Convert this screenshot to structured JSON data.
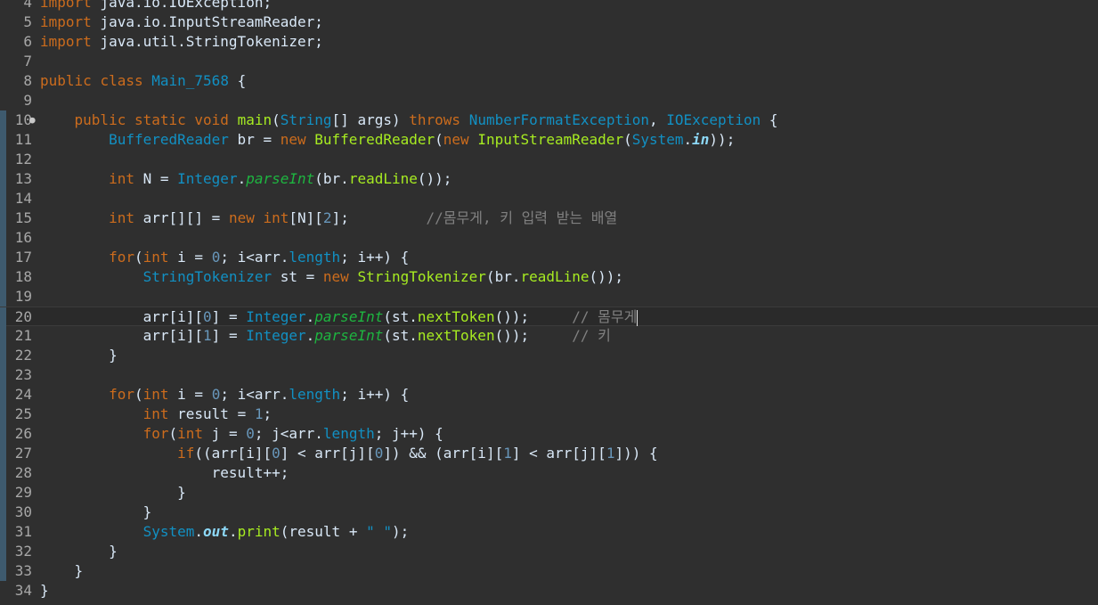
{
  "editor": {
    "fold_marker": "●",
    "lines": [
      {
        "n": "4",
        "tokens": [
          {
            "t": "import",
            "c": "kw"
          },
          {
            "t": " java.io.IOException;"
          }
        ]
      },
      {
        "n": "5",
        "tokens": [
          {
            "t": "import",
            "c": "kw"
          },
          {
            "t": " java.io.InputStreamReader;"
          }
        ]
      },
      {
        "n": "6",
        "tokens": [
          {
            "t": "import",
            "c": "kw"
          },
          {
            "t": " java.util.StringTokenizer;"
          }
        ]
      },
      {
        "n": "7",
        "tokens": []
      },
      {
        "n": "8",
        "tokens": [
          {
            "t": "public",
            "c": "kw"
          },
          {
            "t": " "
          },
          {
            "t": "class",
            "c": "kw"
          },
          {
            "t": " "
          },
          {
            "t": "Main_7568",
            "c": "ty"
          },
          {
            "t": " {"
          }
        ]
      },
      {
        "n": "9",
        "tokens": []
      },
      {
        "n": "10",
        "bar": true,
        "fold": true,
        "tokens": [
          {
            "t": "    "
          },
          {
            "t": "public",
            "c": "kw"
          },
          {
            "t": " "
          },
          {
            "t": "static",
            "c": "kw"
          },
          {
            "t": " "
          },
          {
            "t": "void",
            "c": "kw"
          },
          {
            "t": " "
          },
          {
            "t": "main",
            "c": "fn"
          },
          {
            "t": "("
          },
          {
            "t": "String",
            "c": "ty"
          },
          {
            "t": "[] args) "
          },
          {
            "t": "throws",
            "c": "kw"
          },
          {
            "t": " "
          },
          {
            "t": "NumberFormatException",
            "c": "ty"
          },
          {
            "t": ", "
          },
          {
            "t": "IOException",
            "c": "ty"
          },
          {
            "t": " {"
          }
        ]
      },
      {
        "n": "11",
        "bar": true,
        "tokens": [
          {
            "t": "        "
          },
          {
            "t": "BufferedReader",
            "c": "ty"
          },
          {
            "t": " br = "
          },
          {
            "t": "new",
            "c": "kw"
          },
          {
            "t": " "
          },
          {
            "t": "BufferedReader",
            "c": "fn"
          },
          {
            "t": "("
          },
          {
            "t": "new",
            "c": "kw"
          },
          {
            "t": " "
          },
          {
            "t": "InputStreamReader",
            "c": "fn"
          },
          {
            "t": "("
          },
          {
            "t": "System",
            "c": "ty"
          },
          {
            "t": "."
          },
          {
            "t": "in",
            "c": "sfld"
          },
          {
            "t": "));"
          }
        ]
      },
      {
        "n": "12",
        "bar": true,
        "tokens": []
      },
      {
        "n": "13",
        "bar": true,
        "tokens": [
          {
            "t": "        "
          },
          {
            "t": "int",
            "c": "kw"
          },
          {
            "t": " N = "
          },
          {
            "t": "Integer",
            "c": "ty"
          },
          {
            "t": "."
          },
          {
            "t": "parseInt",
            "c": "st"
          },
          {
            "t": "(br."
          },
          {
            "t": "readLine",
            "c": "fn"
          },
          {
            "t": "());"
          }
        ]
      },
      {
        "n": "14",
        "bar": true,
        "tokens": []
      },
      {
        "n": "15",
        "bar": true,
        "tokens": [
          {
            "t": "        "
          },
          {
            "t": "int",
            "c": "kw"
          },
          {
            "t": " arr[][] = "
          },
          {
            "t": "new",
            "c": "kw"
          },
          {
            "t": " "
          },
          {
            "t": "int",
            "c": "kw"
          },
          {
            "t": "[N]["
          },
          {
            "t": "2",
            "c": "num"
          },
          {
            "t": "];         "
          },
          {
            "t": "//몸무게, 키 입력 받는 배열",
            "c": "cm"
          }
        ]
      },
      {
        "n": "16",
        "bar": true,
        "tokens": []
      },
      {
        "n": "17",
        "bar": true,
        "tokens": [
          {
            "t": "        "
          },
          {
            "t": "for",
            "c": "kw"
          },
          {
            "t": "("
          },
          {
            "t": "int",
            "c": "kw"
          },
          {
            "t": " i = "
          },
          {
            "t": "0",
            "c": "num"
          },
          {
            "t": "; i<arr."
          },
          {
            "t": "length",
            "c": "ty"
          },
          {
            "t": "; i++) {"
          }
        ]
      },
      {
        "n": "18",
        "bar": true,
        "tokens": [
          {
            "t": "            "
          },
          {
            "t": "StringTokenizer",
            "c": "ty"
          },
          {
            "t": " st = "
          },
          {
            "t": "new",
            "c": "kw"
          },
          {
            "t": " "
          },
          {
            "t": "StringTokenizer",
            "c": "fn"
          },
          {
            "t": "(br."
          },
          {
            "t": "readLine",
            "c": "fn"
          },
          {
            "t": "());"
          }
        ]
      },
      {
        "n": "19",
        "bar": true,
        "tokens": []
      },
      {
        "n": "20",
        "bar": true,
        "current": true,
        "cursor": true,
        "tokens": [
          {
            "t": "            arr[i]["
          },
          {
            "t": "0",
            "c": "num"
          },
          {
            "t": "] = "
          },
          {
            "t": "Integer",
            "c": "ty"
          },
          {
            "t": "."
          },
          {
            "t": "parseInt",
            "c": "st"
          },
          {
            "t": "(st."
          },
          {
            "t": "nextToken",
            "c": "fn"
          },
          {
            "t": "());     "
          },
          {
            "t": "// 몸무게",
            "c": "cm"
          }
        ]
      },
      {
        "n": "21",
        "bar": true,
        "tokens": [
          {
            "t": "            arr[i]["
          },
          {
            "t": "1",
            "c": "num"
          },
          {
            "t": "] = "
          },
          {
            "t": "Integer",
            "c": "ty"
          },
          {
            "t": "."
          },
          {
            "t": "parseInt",
            "c": "st"
          },
          {
            "t": "(st."
          },
          {
            "t": "nextToken",
            "c": "fn"
          },
          {
            "t": "());     "
          },
          {
            "t": "// 키",
            "c": "cm"
          }
        ]
      },
      {
        "n": "22",
        "bar": true,
        "tokens": [
          {
            "t": "        }"
          }
        ]
      },
      {
        "n": "23",
        "bar": true,
        "tokens": []
      },
      {
        "n": "24",
        "bar": true,
        "tokens": [
          {
            "t": "        "
          },
          {
            "t": "for",
            "c": "kw"
          },
          {
            "t": "("
          },
          {
            "t": "int",
            "c": "kw"
          },
          {
            "t": " i = "
          },
          {
            "t": "0",
            "c": "num"
          },
          {
            "t": "; i<arr."
          },
          {
            "t": "length",
            "c": "ty"
          },
          {
            "t": "; i++) {"
          }
        ]
      },
      {
        "n": "25",
        "bar": true,
        "tokens": [
          {
            "t": "            "
          },
          {
            "t": "int",
            "c": "kw"
          },
          {
            "t": " result = "
          },
          {
            "t": "1",
            "c": "num"
          },
          {
            "t": ";"
          }
        ]
      },
      {
        "n": "26",
        "bar": true,
        "tokens": [
          {
            "t": "            "
          },
          {
            "t": "for",
            "c": "kw"
          },
          {
            "t": "("
          },
          {
            "t": "int",
            "c": "kw"
          },
          {
            "t": " j = "
          },
          {
            "t": "0",
            "c": "num"
          },
          {
            "t": "; j<arr."
          },
          {
            "t": "length",
            "c": "ty"
          },
          {
            "t": "; j++) {"
          }
        ]
      },
      {
        "n": "27",
        "bar": true,
        "tokens": [
          {
            "t": "                "
          },
          {
            "t": "if",
            "c": "kw"
          },
          {
            "t": "((arr[i]["
          },
          {
            "t": "0",
            "c": "num"
          },
          {
            "t": "] < arr[j]["
          },
          {
            "t": "0",
            "c": "num"
          },
          {
            "t": "]) && (arr[i]["
          },
          {
            "t": "1",
            "c": "num"
          },
          {
            "t": "] < arr[j]["
          },
          {
            "t": "1",
            "c": "num"
          },
          {
            "t": "])) {"
          }
        ]
      },
      {
        "n": "28",
        "bar": true,
        "tokens": [
          {
            "t": "                    result++;"
          }
        ]
      },
      {
        "n": "29",
        "bar": true,
        "tokens": [
          {
            "t": "                }"
          }
        ]
      },
      {
        "n": "30",
        "bar": true,
        "tokens": [
          {
            "t": "            }"
          }
        ]
      },
      {
        "n": "31",
        "bar": true,
        "tokens": [
          {
            "t": "            "
          },
          {
            "t": "System",
            "c": "ty"
          },
          {
            "t": "."
          },
          {
            "t": "out",
            "c": "sfld"
          },
          {
            "t": "."
          },
          {
            "t": "print",
            "c": "fn"
          },
          {
            "t": "(result + "
          },
          {
            "t": "\" \"",
            "c": "ty"
          },
          {
            "t": ");"
          }
        ]
      },
      {
        "n": "32",
        "bar": true,
        "tokens": [
          {
            "t": "        }"
          }
        ]
      },
      {
        "n": "33",
        "bar": true,
        "tokens": [
          {
            "t": "    }"
          }
        ]
      },
      {
        "n": "34",
        "tokens": [
          {
            "t": "}"
          }
        ]
      }
    ]
  }
}
